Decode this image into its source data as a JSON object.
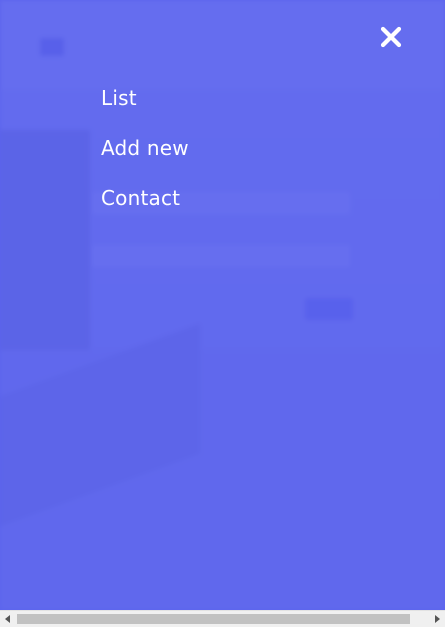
{
  "menu": {
    "items": [
      {
        "label": "List"
      },
      {
        "label": "Add new"
      },
      {
        "label": "Contact"
      }
    ]
  },
  "colors": {
    "overlay": "#5a63ee",
    "menu_text": "#ffffff",
    "scrollbar_track": "#f0f0f0",
    "scrollbar_thumb": "#c1c1c1"
  },
  "icons": {
    "close": "close-icon",
    "scroll_left": "arrow-left-icon",
    "scroll_right": "arrow-right-icon"
  }
}
